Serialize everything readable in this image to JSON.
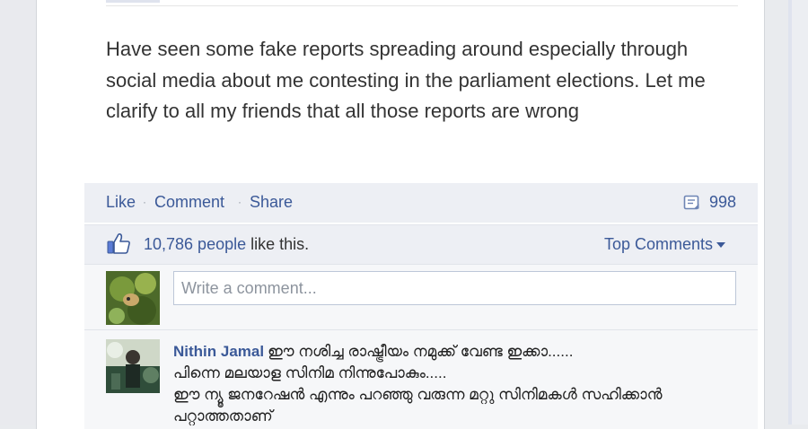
{
  "post": {
    "text": "Have seen some fake reports spreading around especially through social media about me contesting in the parliament elections. Let me clarify to all my friends that all those reports are wrong"
  },
  "actions": {
    "like": "Like",
    "comment": "Comment",
    "share": "Share",
    "separator": "·",
    "share_count": "998"
  },
  "likes": {
    "count": "10,786 people",
    "suffix": " like this.",
    "top_comments": "Top Comments"
  },
  "write_comment": {
    "placeholder": "Write a comment..."
  },
  "comment": {
    "author": "Nithin Jamal",
    "line1": "ഈ നശിച്ച രാഷ്ട്രീയം നമുക്ക് വേണ്ട ഇക്കാ......",
    "line2": "പിന്നെ മലയാള സിനിമ നിന്നുപോകും.....",
    "line3": "ഈ ന്യൂ ജനറേഷൻ എന്നും പറഞ്ഞു വരുന്ന മറ്റു സിനിമകൾ സഹിക്കാൻ",
    "line4": "പറ്റാത്തതാണ്"
  },
  "colors": {
    "link": "#3b5998",
    "bar_bg": "#edeff4",
    "input_border": "#bdc7d8"
  },
  "icons": {
    "share": "share-count-icon",
    "like": "thumbs-up-icon"
  }
}
